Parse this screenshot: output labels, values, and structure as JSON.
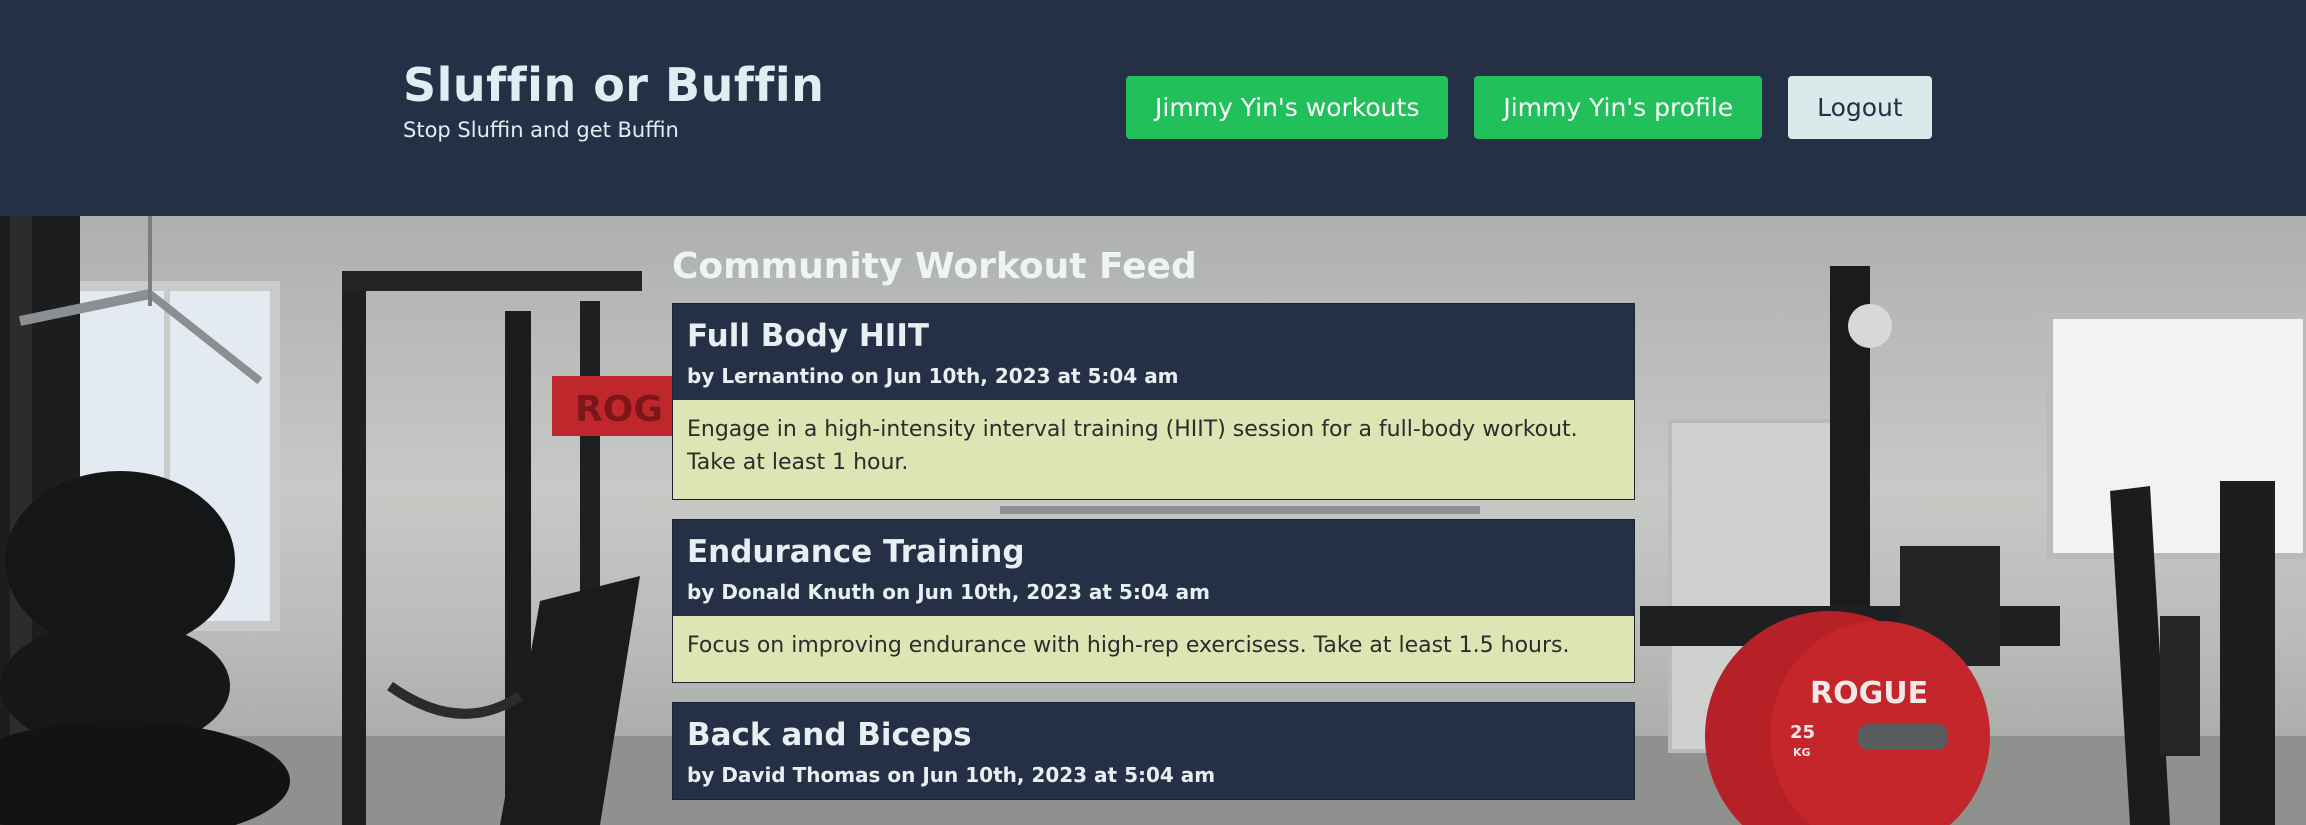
{
  "brand": {
    "title": "Sluffin or Buffin",
    "tagline": "Stop Sluffin and get Buffin"
  },
  "nav": {
    "workouts_label": "Jimmy Yin's workouts",
    "profile_label": "Jimmy Yin's profile",
    "logout_label": "Logout"
  },
  "feed": {
    "title": "Community Workout Feed",
    "workouts": [
      {
        "title": "Full Body HIIT",
        "meta": "by Lernantino on Jun 10th, 2023 at 5:04 am",
        "description": "Engage in a high-intensity interval training (HIIT) session for a full-body workout. Take at least 1 hour."
      },
      {
        "title": "Endurance Training",
        "meta": "by Donald Knuth on Jun 10th, 2023 at 5:04 am",
        "description": "Focus on improving endurance with high-rep exercisess. Take at least 1.5 hours."
      },
      {
        "title": "Back and Biceps",
        "meta": "by David Thomas on Jun 10th, 2023 at 5:04 am",
        "description": ""
      }
    ]
  },
  "colors": {
    "header_bg": "#253047",
    "button_green": "#22c05a",
    "button_light": "#dbe9ea",
    "card_body_bg": "#dce5b3"
  },
  "background": {
    "rack_brand_text": "ROG",
    "plate_brand_text": "ROGUE",
    "plate_weight": "25",
    "plate_unit": "KG"
  }
}
